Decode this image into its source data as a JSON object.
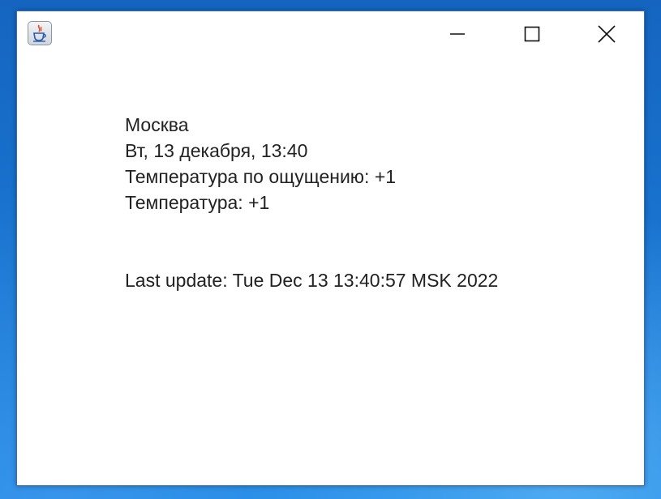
{
  "window": {
    "app_icon": "java-coffee-cup-icon",
    "controls": {
      "minimize": "minimize-icon",
      "maximize": "maximize-icon",
      "close": "close-icon"
    }
  },
  "weather": {
    "city": "Москва",
    "datetime": "Вт, 13 декабря, 13:40",
    "feels_like": "Температура по ощущению: +1",
    "temperature": "Температура: +1",
    "last_update": "Last update: Tue Dec 13 13:40:57 MSK 2022"
  },
  "colors": {
    "desktop": "#1976d2",
    "window_bg": "#ffffff",
    "text": "#222222"
  }
}
